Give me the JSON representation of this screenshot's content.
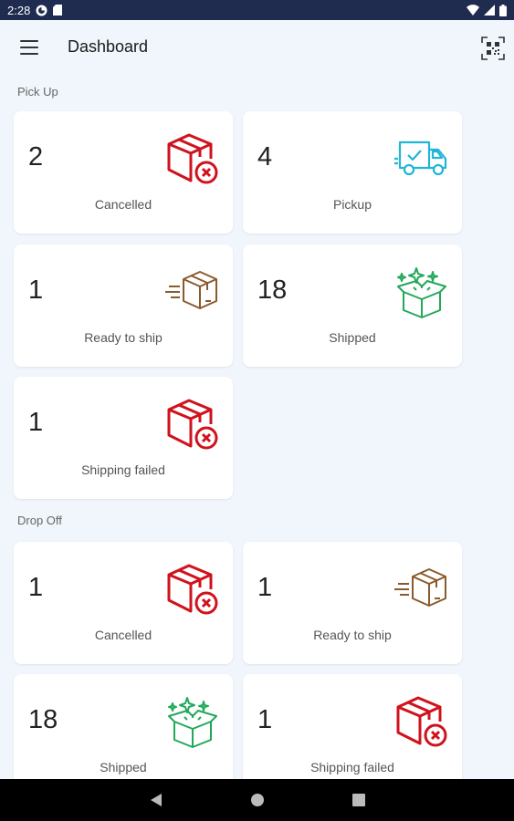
{
  "status_bar": {
    "time": "2:28"
  },
  "app_bar": {
    "title": "Dashboard"
  },
  "pickup": {
    "section_label": "Pick Up",
    "cards": [
      {
        "count": "2",
        "label": "Cancelled",
        "icon": "cancelled-box-icon"
      },
      {
        "count": "4",
        "label": "Pickup",
        "icon": "delivery-truck-icon"
      },
      {
        "count": "1",
        "label": "Ready to ship",
        "icon": "moving-box-icon"
      },
      {
        "count": "18",
        "label": "Shipped",
        "icon": "open-box-sparkles-icon"
      },
      {
        "count": "1",
        "label": "Shipping failed",
        "icon": "cancelled-box-icon"
      }
    ]
  },
  "dropoff": {
    "section_label": "Drop Off",
    "cards": [
      {
        "count": "1",
        "label": "Cancelled",
        "icon": "cancelled-box-icon"
      },
      {
        "count": "1",
        "label": "Ready to ship",
        "icon": "moving-box-icon"
      },
      {
        "count": "18",
        "label": "Shipped",
        "icon": "open-box-sparkles-icon"
      },
      {
        "count": "1",
        "label": "Shipping failed",
        "icon": "cancelled-box-icon"
      }
    ]
  },
  "colors": {
    "cancelled": "#d0121d",
    "pickup": "#1fb6d8",
    "ready": "#8a5a2b",
    "shipped": "#22a85a",
    "status_bar": "#1f2b4f",
    "background": "#f0f6fc"
  }
}
